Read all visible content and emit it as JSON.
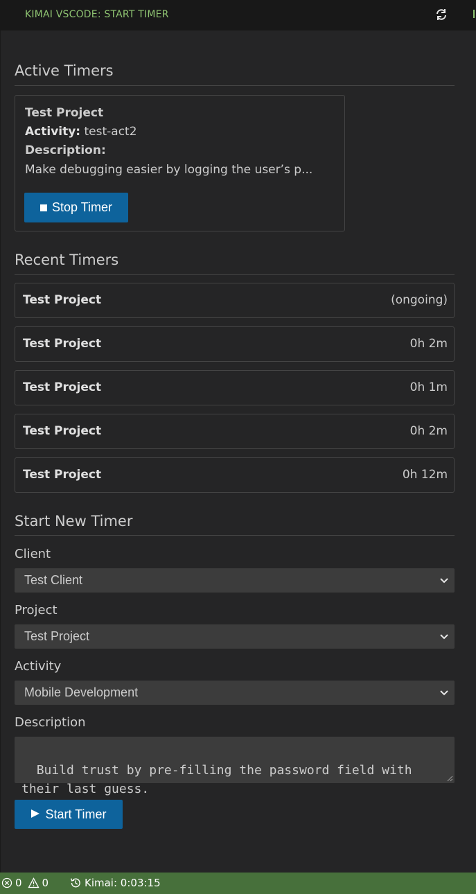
{
  "header": {
    "title": "KIMAI VSCODE: START TIMER",
    "refresh_icon": "refresh-icon",
    "accent_color": "#8fc472"
  },
  "active_timers": {
    "section_title": "Active Timers",
    "card": {
      "project": "Test Project",
      "activity_label": "Activity:",
      "activity_value": "test-act2",
      "description_label": "Description:",
      "description_value": "Make debugging easier by logging the user’s p...",
      "stop_button_label": "Stop Timer",
      "stop_icon": "stop-icon"
    }
  },
  "recent_timers": {
    "section_title": "Recent Timers",
    "items": [
      {
        "project": "Test Project",
        "duration": "(ongoing)"
      },
      {
        "project": "Test Project",
        "duration": "0h 2m"
      },
      {
        "project": "Test Project",
        "duration": "0h 1m"
      },
      {
        "project": "Test Project",
        "duration": "0h 2m"
      },
      {
        "project": "Test Project",
        "duration": "0h 12m"
      }
    ]
  },
  "start_new_timer": {
    "section_title": "Start New Timer",
    "client": {
      "label": "Client",
      "selected": "Test Client"
    },
    "project": {
      "label": "Project",
      "selected": "Test Project"
    },
    "activity": {
      "label": "Activity",
      "selected": "Mobile Development"
    },
    "description": {
      "label": "Description",
      "value": "Build trust by pre-filling the password field with\ntheir last guess."
    },
    "start_button_label": "Start Timer",
    "play_icon": "play-icon"
  },
  "status_bar": {
    "errors": "0",
    "warnings": "0",
    "kimai_label": "Kimai: 0:03:15",
    "background_color": "#47703b"
  },
  "colors": {
    "button_primary": "#0e639c",
    "panel_background": "#252526"
  }
}
